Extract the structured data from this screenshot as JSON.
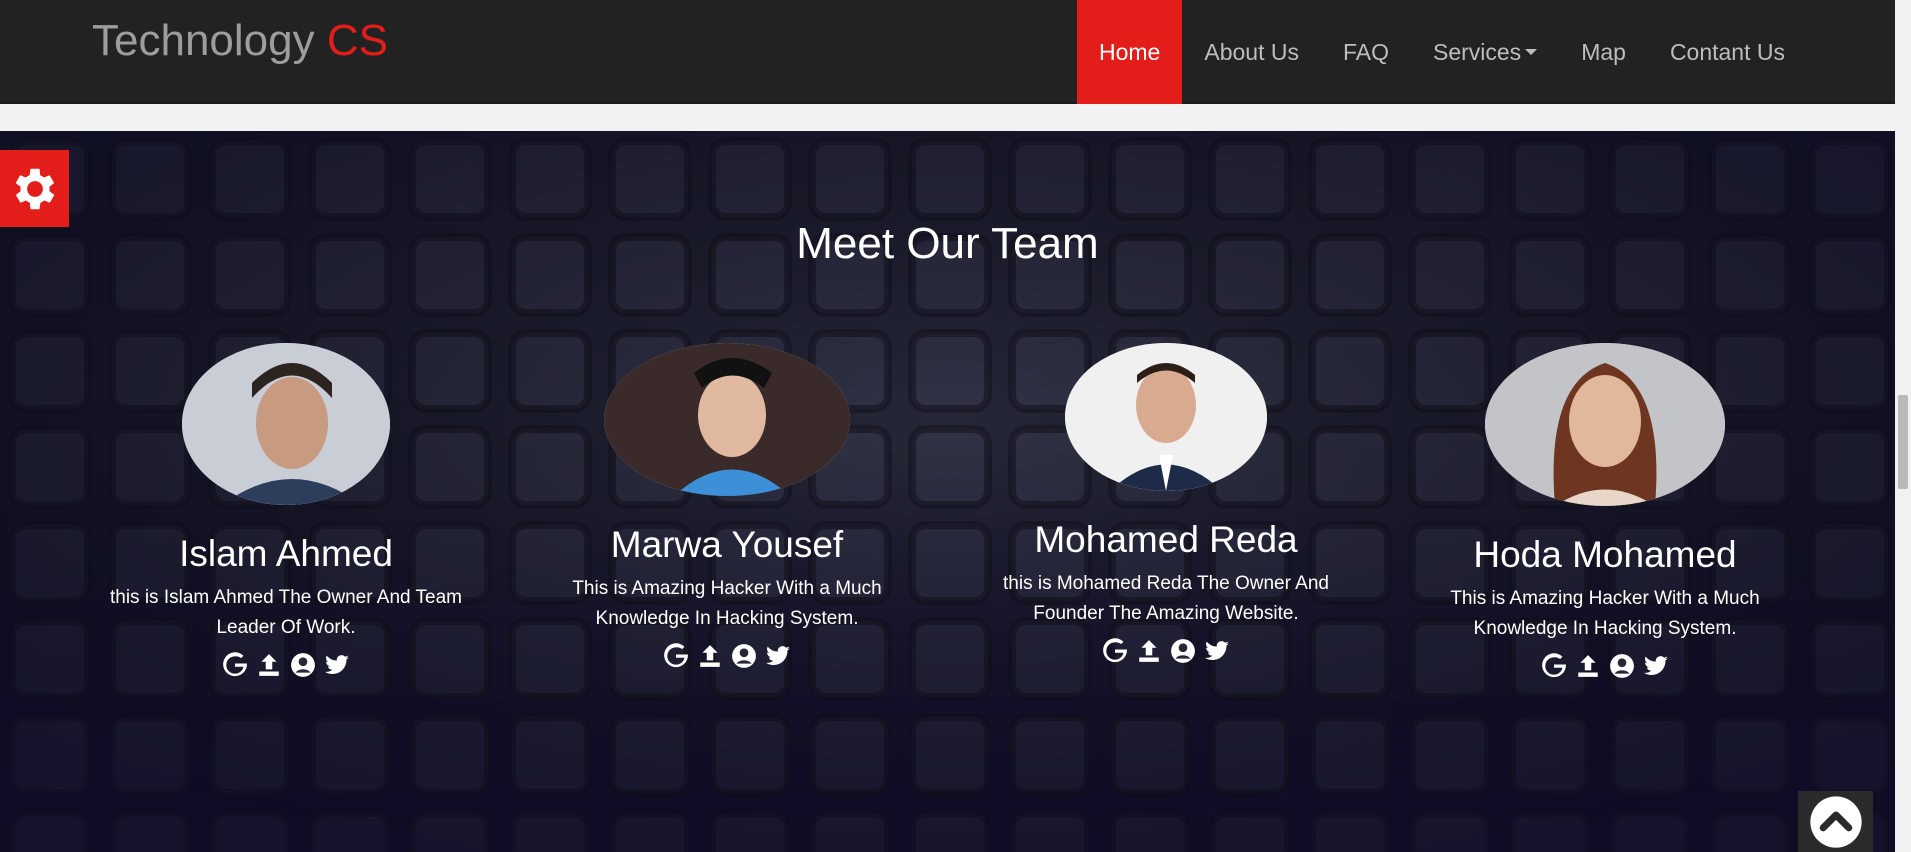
{
  "brand": {
    "name": "Technology",
    "accent": "CS"
  },
  "nav": {
    "items": [
      {
        "label": "Home"
      },
      {
        "label": "About Us"
      },
      {
        "label": "FAQ"
      },
      {
        "label": "Services"
      },
      {
        "label": "Map"
      },
      {
        "label": "Contant Us"
      }
    ],
    "active": "Home"
  },
  "team": {
    "title": "Meet Our Team",
    "members": [
      {
        "name": "Islam Ahmed",
        "bio": "this is Islam Ahmed The Owner And Team Leader Of Work."
      },
      {
        "name": "Marwa Yousef",
        "bio": "This is Amazing Hacker With a Much Knowledge In Hacking System."
      },
      {
        "name": "Mohamed Reda",
        "bio": "this is Mohamed Reda The Owner And Founder The Amazing Website."
      },
      {
        "name": "Hoda Mohamed",
        "bio": "This is Amazing Hacker With a Much Knowledge In Hacking System."
      }
    ],
    "social_icons": [
      "google-icon",
      "upload-icon",
      "user-circle-icon",
      "twitter-icon"
    ]
  },
  "widgets": {
    "settings_icon": "gear-icon",
    "scroll_top_icon": "chevron-up-icon"
  },
  "colors": {
    "accent": "#e31d1a",
    "navbar": "#222222",
    "nav_text": "#bdbdbd"
  }
}
